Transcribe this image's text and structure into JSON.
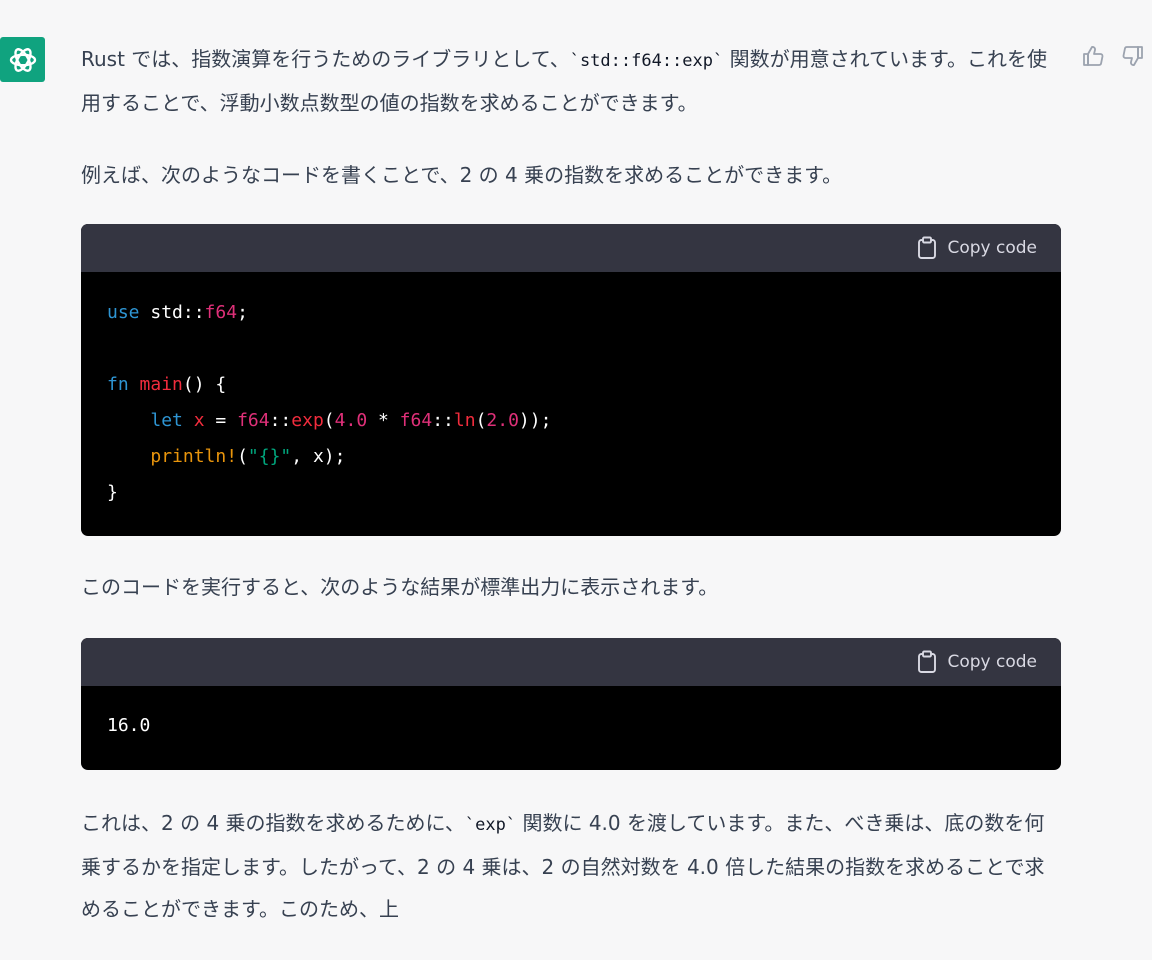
{
  "colors": {
    "avatar_bg": "#10a37f",
    "code_header_bg": "#343541",
    "code_body_bg": "#000000",
    "keyword": "#2e95d3",
    "type": "#df3079",
    "function": "#f22c3d",
    "string": "#00a67d",
    "macro": "#e9950c"
  },
  "icons": {
    "avatar": "openai-logo-icon",
    "like": "thumbs-up-icon",
    "dislike": "thumbs-down-icon",
    "copy": "clipboard-icon"
  },
  "message": {
    "p1_before": "Rust では、指数演算を行うためのライブラリとして、",
    "p1_code": "`std::f64::exp`",
    "p1_after": " 関数が用意されています。これを使用することで、浮動小数点数型の値の指数を求めることができます。",
    "p2": "例えば、次のようなコードを書くことで、2 の 4 乗の指数を求めることができます。",
    "p3": "このコードを実行すると、次のような結果が標準出力に表示されます。",
    "p4_before": "これは、2 の 4 乗の指数を求めるために、",
    "p4_code": "`exp`",
    "p4_after": " 関数に 4.0 を渡しています。また、べき乗は、底の数を何乗するかを指定します。したがって、2 の 4 乗は、2 の自然対数を 4.0 倍した結果の指数を求めることで求めることができます。このため、上"
  },
  "code_block_1": {
    "copy_label": "Copy code",
    "t_use": "use",
    "t_std": " std::",
    "t_f64a": "f64",
    "t_semi1": ";",
    "t_fn": "fn",
    "t_main": "main",
    "t_mainrest": "() {",
    "t_indent1": "    ",
    "t_let": "let",
    "t_x": "x",
    "t_eq": " = ",
    "t_f64b": "f64",
    "t_colons1": "::",
    "t_exp": "exp",
    "t_paren1": "(",
    "t_num1": "4.0",
    "t_mul": " * ",
    "t_f64c": "f64",
    "t_colons2": "::",
    "t_ln": "ln",
    "t_paren2": "(",
    "t_num2": "2.0",
    "t_close1": "));",
    "t_println": "println!",
    "t_paren3": "(",
    "t_str": "\"{}\"",
    "t_rest": ", x);",
    "t_close2": "}"
  },
  "code_block_2": {
    "copy_label": "Copy code",
    "output": "16.0"
  }
}
